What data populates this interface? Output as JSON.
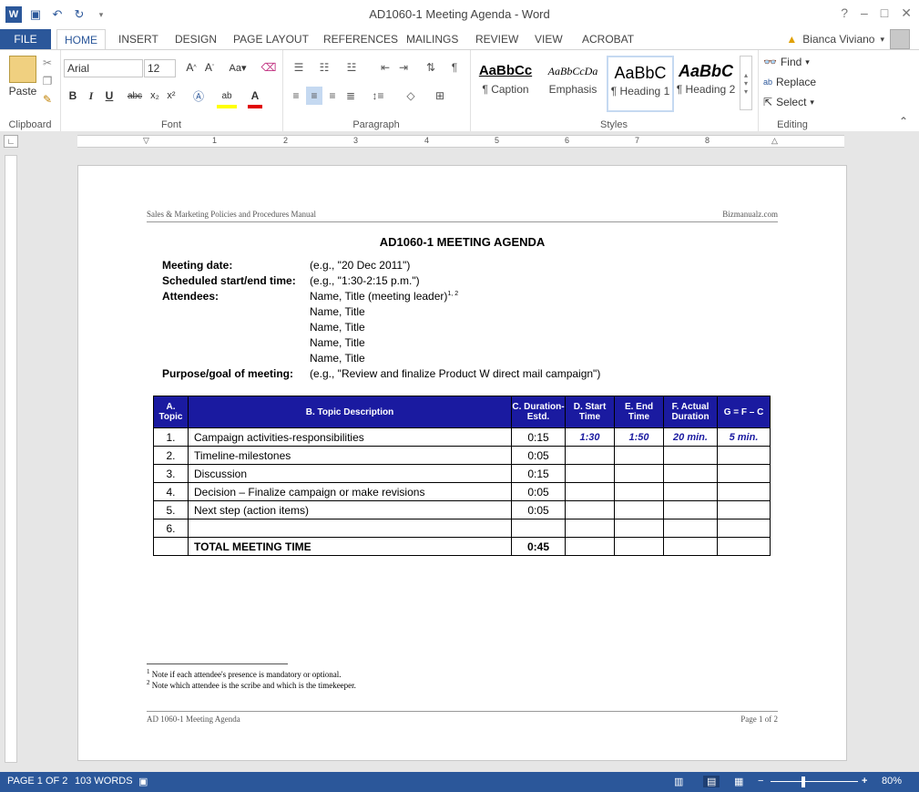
{
  "window": {
    "title": "AD1060-1 Meeting Agenda - Word",
    "help": "?",
    "minimize": "–",
    "maximize": "□",
    "close": "✕"
  },
  "qat": {
    "save_icon": "save-icon",
    "undo_icon": "undo-icon",
    "redo_icon": "redo-icon"
  },
  "tabs": [
    "FILE",
    "HOME",
    "INSERT",
    "DESIGN",
    "PAGE LAYOUT",
    "REFERENCES",
    "MAILINGS",
    "REVIEW",
    "VIEW",
    "ACROBAT"
  ],
  "user": {
    "name": "Bianca Viviano"
  },
  "ribbon": {
    "clipboard": {
      "paste": "Paste",
      "label": "Clipboard"
    },
    "font": {
      "name": "Arial",
      "size": "12",
      "label": "Font"
    },
    "paragraph": {
      "label": "Paragraph"
    },
    "styles": {
      "label": "Styles",
      "items": [
        {
          "preview": "AaBbCc",
          "name": "¶ Caption"
        },
        {
          "preview": "AaBbCcDa",
          "name": "Emphasis"
        },
        {
          "preview": "AaBbC",
          "name": "¶ Heading 1"
        },
        {
          "preview": "AaBbC",
          "name": "¶ Heading 2"
        }
      ]
    },
    "editing": {
      "find": "Find",
      "replace": "Replace",
      "select": "Select",
      "label": "Editing"
    }
  },
  "document": {
    "header_left": "Sales & Marketing Policies and Procedures Manual",
    "header_right": "Bizmanualz.com",
    "heading": "AD1060-1 MEETING AGENDA",
    "fields": {
      "date_label": "Meeting date:",
      "date_value": "(e.g., \"20 Dec 2011\")",
      "time_label": "Scheduled start/end time:",
      "time_value": "(e.g., \"1:30-2:15 p.m.\")",
      "attendees_label": "Attendees:",
      "attendee_1": "Name, Title (meeting leader)",
      "attendee_1_sup": "1, 2",
      "attendee_2": "Name, Title",
      "attendee_3": "Name, Title",
      "attendee_4": "Name, Title",
      "attendee_5": "Name, Title",
      "purpose_label": "Purpose/goal of meeting:",
      "purpose_value": "(e.g., \"Review and finalize Product W direct mail campaign\")"
    },
    "table": {
      "headers": [
        "A. Topic",
        "B. Topic Description",
        "C. Duration-Estd.",
        "D. Start Time",
        "E. End Time",
        "F. Actual Duration",
        "G = F – C"
      ],
      "rows": [
        [
          "1.",
          "Campaign activities-responsibilities",
          "0:15",
          "1:30",
          "1:50",
          "20 min.",
          "5 min."
        ],
        [
          "2.",
          "Timeline-milestones",
          "0:05",
          "",
          "",
          "",
          ""
        ],
        [
          "3.",
          "Discussion",
          "0:15",
          "",
          "",
          "",
          ""
        ],
        [
          "4.",
          "Decision – Finalize campaign or make revisions",
          "0:05",
          "",
          "",
          "",
          ""
        ],
        [
          "5.",
          "Next step (action items)",
          "0:05",
          "",
          "",
          "",
          ""
        ],
        [
          "6.",
          "",
          "",
          "",
          "",
          "",
          ""
        ]
      ],
      "total_label": "TOTAL MEETING TIME",
      "total_value": "0:45"
    },
    "footnote_1": "Note if each attendee's presence is mandatory or optional.",
    "footnote_2": "Note which attendee is the scribe and which is the timekeeper.",
    "footer_left": "AD 1060-1 Meeting Agenda",
    "footer_right": "Page 1 of 2"
  },
  "status": {
    "page": "PAGE 1 OF 2",
    "words": "103 WORDS",
    "zoom": "80%"
  }
}
